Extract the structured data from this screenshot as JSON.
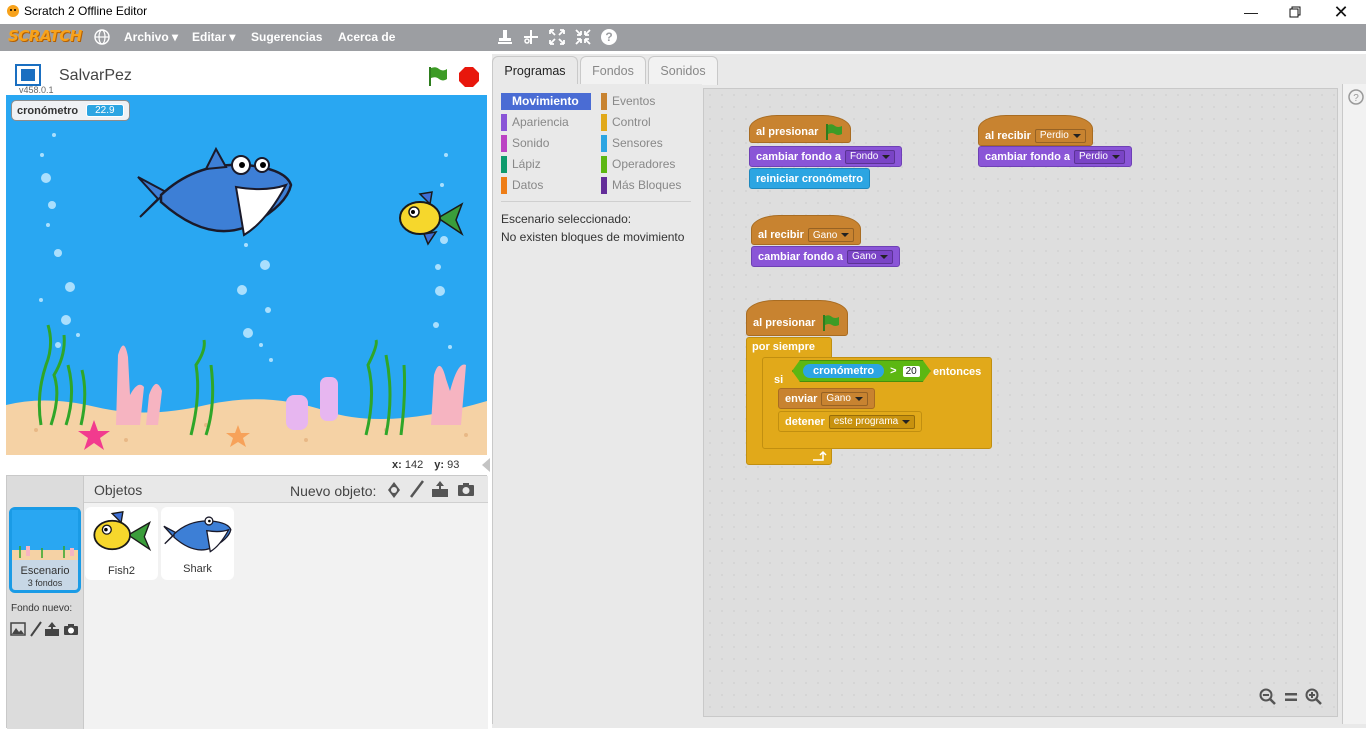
{
  "window": {
    "title": "Scratch 2 Offline Editor"
  },
  "menubar": {
    "logo": "SCRATCH",
    "items": [
      "Archivo",
      "Editar",
      "Sugerencias",
      "Acerca de"
    ]
  },
  "stage": {
    "project_name": "SalvarPez",
    "version": "v458.0.1",
    "monitor_label": "cronómetro",
    "monitor_value": "22.9",
    "x_label": "x:",
    "x_value": "142",
    "y_label": "y:",
    "y_value": "93"
  },
  "sprites": {
    "objects_label": "Objetos",
    "new_object_label": "Nuevo objeto:",
    "stage_thumb": {
      "name": "Escenario",
      "sub": "3 fondos"
    },
    "new_backdrop_label": "Fondo nuevo:",
    "items": [
      {
        "name": "Fish2"
      },
      {
        "name": "Shark"
      }
    ]
  },
  "tabs": [
    "Programas",
    "Fondos",
    "Sonidos"
  ],
  "palette": {
    "categories_left": [
      {
        "label": "Movimiento",
        "color": "#4a6cd4",
        "selected": true
      },
      {
        "label": "Apariencia",
        "color": "#8a55d7"
      },
      {
        "label": "Sonido",
        "color": "#bb42c3"
      },
      {
        "label": "Lápiz",
        "color": "#0e9a6c"
      },
      {
        "label": "Datos",
        "color": "#ee7d16"
      }
    ],
    "categories_right": [
      {
        "label": "Eventos",
        "color": "#c88330"
      },
      {
        "label": "Control",
        "color": "#e1a91a"
      },
      {
        "label": "Sensores",
        "color": "#2ca5e2"
      },
      {
        "label": "Operadores",
        "color": "#5cb712"
      },
      {
        "label": "Más Bloques",
        "color": "#632d99"
      }
    ],
    "message_line1": "Escenario seleccionado:",
    "message_line2": "No existen bloques de movimiento"
  },
  "scripts": {
    "s1_hat": "al presionar",
    "s1_b1": "cambiar fondo a",
    "s1_b1_dd": "Fondo",
    "s1_b2": "reiniciar cronómetro",
    "s2_hat": "al recibir",
    "s2_hat_dd": "Perdio",
    "s2_b1": "cambiar fondo a",
    "s2_b1_dd": "Perdio",
    "s3_hat": "al recibir",
    "s3_hat_dd": "Gano",
    "s3_b1": "cambiar fondo a",
    "s3_b1_dd": "Gano",
    "s4_hat": "al presionar",
    "s4_forever": "por siempre",
    "s4_if": "si",
    "s4_reporter": "cronómetro",
    "s4_op": ">",
    "s4_num": "20",
    "s4_then": "entonces",
    "s4_send": "enviar",
    "s4_send_dd": "Gano",
    "s4_stop": "detener",
    "s4_stop_dd": "este programa"
  },
  "colors": {
    "menubar": "#9c9ea2",
    "stage_water": "#29a7f2",
    "events": "#c88330",
    "looks": "#8a55d7",
    "sensing": "#2ca5e2",
    "control": "#e1a91a",
    "operators": "#5cb712"
  }
}
